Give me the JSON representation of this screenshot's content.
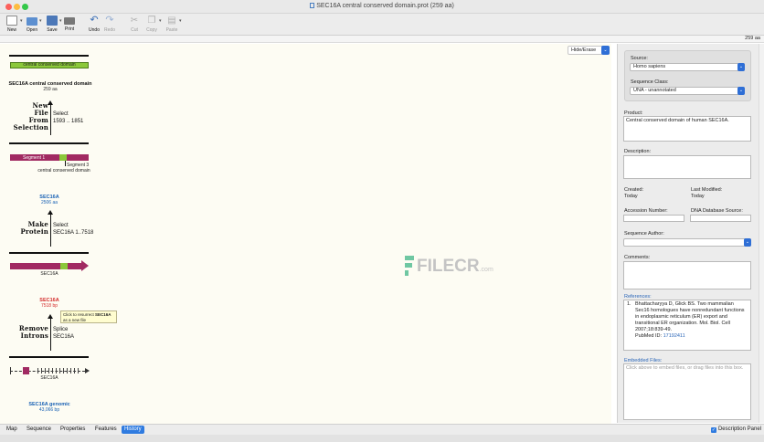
{
  "window": {
    "title": "SEC16A central conserved domain.prot  (259 aa)"
  },
  "toolbar": {
    "new": "New",
    "open": "Open",
    "save": "Save",
    "print": "Print",
    "undo": "Undo",
    "redo": "Redo",
    "cut": "Cut",
    "copy": "Copy",
    "paste": "Paste"
  },
  "length_strip": "259 aa",
  "hide_erase": "Hide/Erase",
  "history": {
    "top_feature_label": "central conserved domain",
    "node1": {
      "name": "SEC16A central conserved domain",
      "length": "259 aa"
    },
    "op1": {
      "name": [
        "New",
        "File",
        "From",
        "Selection"
      ],
      "detail": [
        "Select",
        "1593 .. 1851"
      ]
    },
    "node2": {
      "segment1": "Segment 1",
      "segment3": "Segment 3",
      "feature": "central conserved domain"
    },
    "node3": {
      "name": "SEC16A",
      "length": "2506 aa"
    },
    "op2": {
      "name": [
        "Make",
        "Protein"
      ],
      "detail": [
        "Select",
        "SEC16A 1..7518"
      ]
    },
    "node4": {
      "label": "SEC16A"
    },
    "node5": {
      "name": "SEC16A",
      "length": "7518 bp"
    },
    "tooltip": {
      "prefix": "Click to resurrect ",
      "bold": "SEC16A",
      "suffix": "as a new file"
    },
    "op3": {
      "name": [
        "Remove",
        "Introns"
      ],
      "detail": [
        "Splice",
        "SEC16A"
      ]
    },
    "node6": {
      "label": "SEC16A"
    },
    "node7": {
      "name": "SEC16A genomic",
      "length": "43,066 bp"
    }
  },
  "watermark": {
    "main": "FILECR",
    "suffix": ".com"
  },
  "tabs": [
    "Map",
    "Sequence",
    "Properties",
    "Features",
    "History"
  ],
  "active_tab": "History",
  "description_panel_toggle": "Description Panel",
  "panel": {
    "source_label": "Source:",
    "source_value": "Homo sapiens",
    "class_label": "Sequence Class:",
    "class_value": "UNA - unannotated",
    "product_label": "Product:",
    "product_value": "Central conserved domain of human SEC16A.",
    "description_label": "Description:",
    "created_label": "Created:",
    "created_value": "Today",
    "modified_label": "Last Modified:",
    "modified_value": "Today",
    "accession_label": "Accession Number:",
    "dbsource_label": "DNA Database Source:",
    "author_label": "Sequence Author:",
    "comments_label": "Comments:",
    "references_label": "References:",
    "reference": {
      "number": "1.",
      "text": "Bhattacharyya D, Glick BS. Two mammalian Sec16 homologues have nonredundant functions in endoplasmic reticulum (ER) export and transitional ER organization. Mol. Biol. Cell 2007;18:839-49.",
      "pubmed_label": "PubMed ID:",
      "pubmed_id": "17192411"
    },
    "embedded_label": "Embedded Files:",
    "embedded_placeholder": "Click above to embed files, or drag files into this box."
  },
  "colors": {
    "feature_green": "#8bc83a",
    "segment_magenta": "#a12a62",
    "link_blue": "#1a62b5",
    "deleted_red": "#d42b2b",
    "accent": "#2f7be0"
  }
}
